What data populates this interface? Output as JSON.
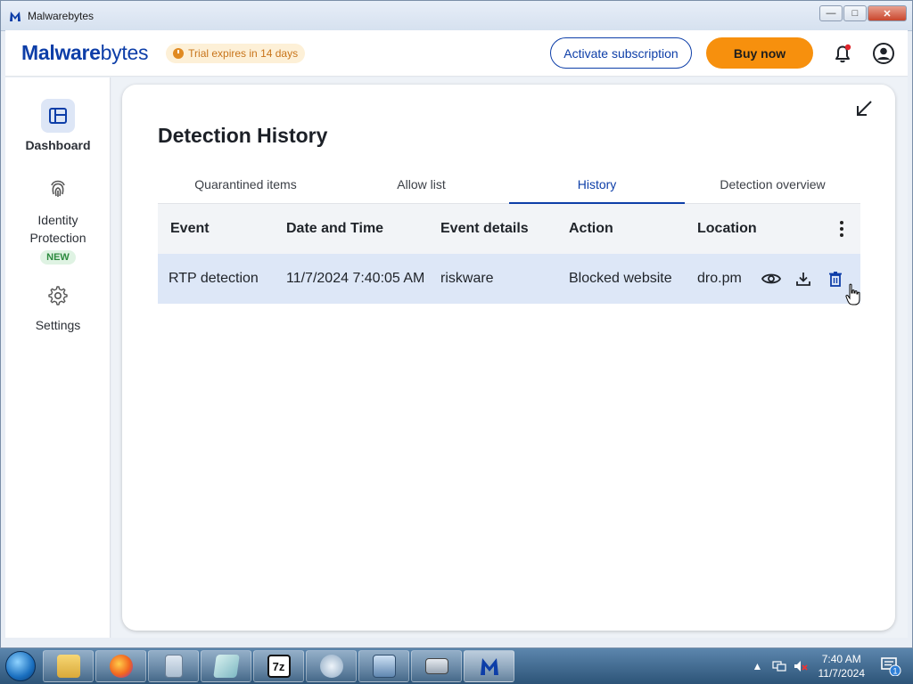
{
  "window": {
    "title": "Malwarebytes",
    "controls": {
      "minimize": "—",
      "maximize": "□",
      "close": "✕"
    }
  },
  "header": {
    "brand_bold": "Malware",
    "brand_rest": "bytes",
    "trial_text": "Trial expires in 14 days",
    "activate_label": "Activate subscription",
    "buy_label": "Buy now",
    "icons": [
      "bell-icon",
      "account-icon"
    ],
    "accent_color": "#0d3ea8",
    "buy_color": "#f7900d",
    "notification_dot_color": "#e0262c"
  },
  "sidebar": {
    "items": [
      {
        "label": "Dashboard",
        "icon": "dashboard-icon",
        "active": true
      },
      {
        "label": "Identity Protection",
        "badge": "NEW",
        "icon": "fingerprint-icon",
        "active": false
      },
      {
        "label": "Settings",
        "icon": "gear-icon",
        "active": false
      }
    ]
  },
  "main": {
    "title": "Detection History",
    "tabs": [
      {
        "label": "Quarantined items",
        "active": false
      },
      {
        "label": "Allow list",
        "active": false
      },
      {
        "label": "History",
        "active": true
      },
      {
        "label": "Detection overview",
        "active": false
      }
    ],
    "table": {
      "columns": [
        "Event",
        "Date and Time",
        "Event details",
        "Action",
        "Location"
      ],
      "rows": [
        {
          "event": "RTP detection",
          "datetime": "11/7/2024 7:40:05 AM",
          "details": "riskware",
          "action": "Blocked website",
          "location": "dro.pm"
        }
      ],
      "row_actions": [
        "view-icon",
        "download-icon",
        "delete-icon"
      ]
    }
  },
  "taskbar": {
    "apps": [
      "windows-explorer",
      "firefox",
      "notepad",
      "sticky-notes",
      "7-zip",
      "media-player",
      "network",
      "remote-desktop",
      "malwarebytes"
    ],
    "active_app": "malwarebytes",
    "seven_zip_label": "7z",
    "time": "7:40 AM",
    "date": "11/7/2024",
    "notification_count": "1"
  }
}
